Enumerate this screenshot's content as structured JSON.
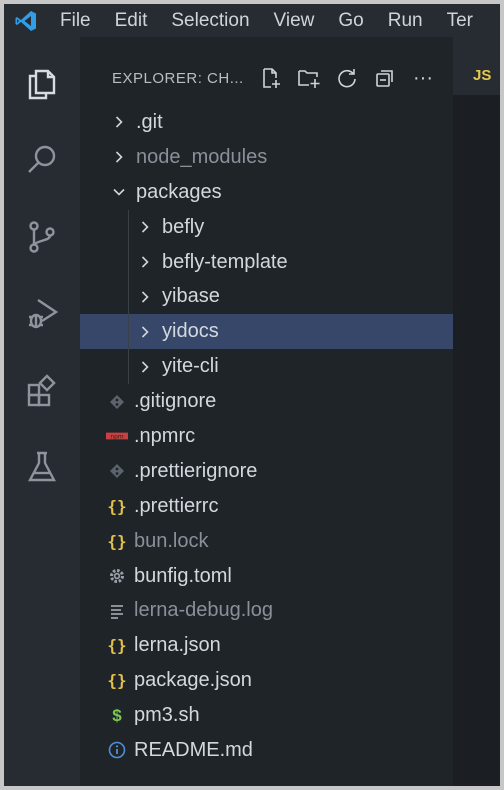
{
  "menubar": {
    "items": [
      "File",
      "Edit",
      "Selection",
      "View",
      "Go",
      "Run",
      "Ter"
    ]
  },
  "activity_bar": {
    "icons": [
      "files-icon",
      "search-icon",
      "source-control-icon",
      "run-debug-icon",
      "extensions-icon",
      "testing-icon"
    ]
  },
  "sidebar": {
    "title": "EXPLORER: CH...",
    "actions": [
      "new-file-icon",
      "new-folder-icon",
      "refresh-icon",
      "collapse-all-icon",
      "more-icon"
    ],
    "more_label": "···"
  },
  "editor": {
    "tab_badge": "JS"
  },
  "tree": [
    {
      "label": ".git",
      "type": "folder",
      "depth": 0,
      "expanded": false,
      "dim": false
    },
    {
      "label": "node_modules",
      "type": "folder",
      "depth": 0,
      "expanded": false,
      "dim": true
    },
    {
      "label": "packages",
      "type": "folder",
      "depth": 0,
      "expanded": true,
      "dim": false
    },
    {
      "label": "befly",
      "type": "folder",
      "depth": 1,
      "expanded": false,
      "dim": false
    },
    {
      "label": "befly-template",
      "type": "folder",
      "depth": 1,
      "expanded": false,
      "dim": false
    },
    {
      "label": "yibase",
      "type": "folder",
      "depth": 1,
      "expanded": false,
      "dim": false
    },
    {
      "label": "yidocs",
      "type": "folder",
      "depth": 1,
      "expanded": false,
      "dim": false,
      "selected": true
    },
    {
      "label": "yite-cli",
      "type": "folder",
      "depth": 1,
      "expanded": false,
      "dim": false
    },
    {
      "label": ".gitignore",
      "type": "git",
      "depth": 0,
      "dim": false
    },
    {
      "label": ".npmrc",
      "type": "npm",
      "depth": 0,
      "dim": false
    },
    {
      "label": ".prettierignore",
      "type": "git",
      "depth": 0,
      "dim": false
    },
    {
      "label": ".prettierrc",
      "type": "json",
      "depth": 0,
      "dim": false
    },
    {
      "label": "bun.lock",
      "type": "json",
      "depth": 0,
      "dim": true
    },
    {
      "label": "bunfig.toml",
      "type": "gear",
      "depth": 0,
      "dim": false
    },
    {
      "label": "lerna-debug.log",
      "type": "log",
      "depth": 0,
      "dim": true
    },
    {
      "label": "lerna.json",
      "type": "json",
      "depth": 0,
      "dim": false
    },
    {
      "label": "package.json",
      "type": "json",
      "depth": 0,
      "dim": false
    },
    {
      "label": "pm3.sh",
      "type": "shell",
      "depth": 0,
      "dim": false
    },
    {
      "label": "README.md",
      "type": "info",
      "depth": 0,
      "dim": false
    }
  ],
  "colors": {
    "accent_logo": "#2f9ee6",
    "selection": "#37476a",
    "json_icon": "#e3c14b",
    "npm_icon": "#c94040",
    "shell_icon": "#7cc653",
    "info_icon": "#4f8fd8"
  }
}
